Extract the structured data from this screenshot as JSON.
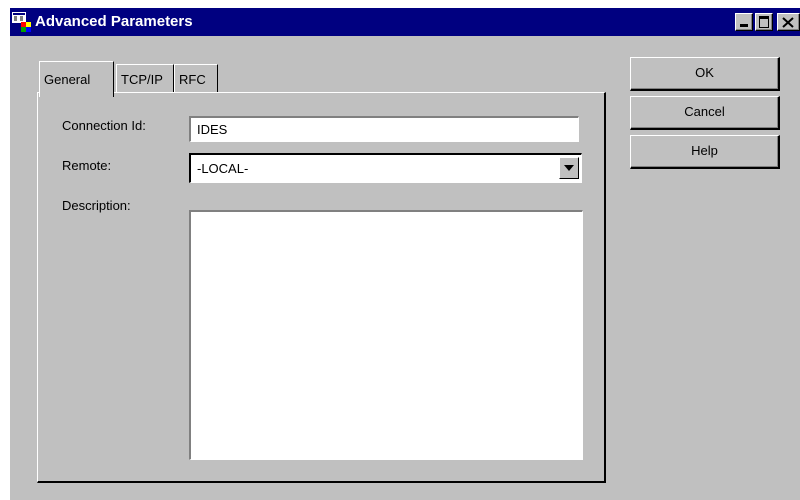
{
  "window": {
    "title": "Advanced Parameters",
    "icon": "app-window-icon",
    "controls": [
      "minimize-icon",
      "maximize-icon",
      "close-icon"
    ]
  },
  "tabs": [
    {
      "label": "General",
      "active": true
    },
    {
      "label": "TCP/IP",
      "active": false
    },
    {
      "label": "RFC",
      "active": false
    }
  ],
  "form": {
    "connection_id": {
      "label": "Connection Id:",
      "value": "IDES"
    },
    "remote": {
      "label": "Remote:",
      "value": "-LOCAL-"
    },
    "description": {
      "label": "Description:",
      "value": ""
    }
  },
  "buttons": {
    "ok": "OK",
    "cancel": "Cancel",
    "help": "Help"
  },
  "colors": {
    "titlebar": "#000080",
    "face": "#c0c0c0",
    "field": "#ffffff"
  }
}
